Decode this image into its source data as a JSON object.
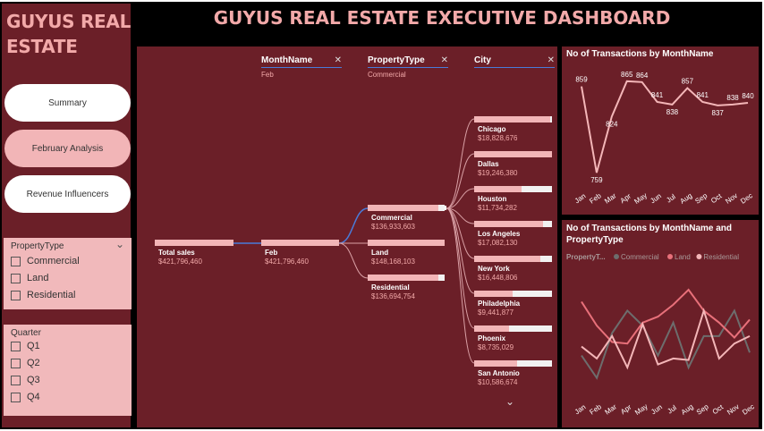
{
  "app": {
    "title": "GUYUS REAL ESTATE",
    "dashboard_title": "GUYUS REAL ESTATE EXECUTIVE DASHBOARD"
  },
  "nav": {
    "summary": "Summary",
    "february": "February Analysis",
    "revenue": "Revenue Influencers"
  },
  "slicers": {
    "property_type": {
      "title": "PropertyType",
      "options": [
        "Commercial",
        "Land",
        "Residential"
      ]
    },
    "quarter": {
      "title": "Quarter",
      "options": [
        "Q1",
        "Q2",
        "Q3",
        "Q4"
      ]
    }
  },
  "tree": {
    "levels": [
      {
        "name": "MonthName",
        "selected": "Feb"
      },
      {
        "name": "PropertyType",
        "selected": "Commercial"
      },
      {
        "name": "City",
        "selected": ""
      }
    ],
    "root": {
      "label": "Total sales",
      "value": "$421,796,460"
    },
    "month": {
      "label": "Feb",
      "value": "$421,796,460"
    },
    "types": [
      {
        "label": "Commercial",
        "value": "$136,933,603",
        "fill": 0.92
      },
      {
        "label": "Land",
        "value": "$148,168,103",
        "fill": 1.0
      },
      {
        "label": "Residential",
        "value": "$136,694,754",
        "fill": 0.92
      }
    ],
    "cities": [
      {
        "label": "Chicago",
        "value": "$18,828,676",
        "fill": 0.98
      },
      {
        "label": "Dallas",
        "value": "$19,246,380",
        "fill": 1.0
      },
      {
        "label": "Houston",
        "value": "$11,734,282",
        "fill": 0.61
      },
      {
        "label": "Los Angeles",
        "value": "$17,082,130",
        "fill": 0.89
      },
      {
        "label": "New York",
        "value": "$16,448,806",
        "fill": 0.85
      },
      {
        "label": "Philadelphia",
        "value": "$9,441,877",
        "fill": 0.49
      },
      {
        "label": "Phoenix",
        "value": "$8,735,029",
        "fill": 0.45
      },
      {
        "label": "San Antonio",
        "value": "$10,586,674",
        "fill": 0.55
      }
    ],
    "more_icon": "chevron-down-icon"
  },
  "chart1": {
    "title": "No of Transactions by MonthName"
  },
  "chart2": {
    "title": "No of Transactions by MonthName and PropertyType",
    "legend_title": "PropertyT...",
    "colors": [
      "#6d6d6d",
      "#e8707a",
      "#f4b6b8"
    ]
  },
  "chart_data": [
    {
      "type": "line",
      "title": "No of Transactions by MonthName",
      "categories": [
        "Jan",
        "Feb",
        "Mar",
        "Apr",
        "May",
        "Jun",
        "Jul",
        "Aug",
        "Sep",
        "Oct",
        "Nov",
        "Dec"
      ],
      "series": [
        {
          "values": [
            859,
            759,
            824,
            865,
            864,
            841,
            838,
            857,
            841,
            837,
            838,
            840
          ]
        }
      ],
      "ylim": [
        755,
        870
      ],
      "color": "#f4b6b8"
    },
    {
      "type": "line",
      "title": "No of Transactions by MonthName and PropertyType",
      "categories": [
        "Jan",
        "Feb",
        "Mar",
        "Apr",
        "May",
        "Jun",
        "Jul",
        "Aug",
        "Sep",
        "Oct",
        "Nov",
        "Dec"
      ],
      "series": [
        {
          "name": "Commercial",
          "values": [
            270,
            255,
            285,
            300,
            290,
            270,
            292,
            262,
            283,
            283,
            300,
            272
          ]
        },
        {
          "name": "Land",
          "values": [
            306,
            290,
            279,
            278,
            292,
            296,
            304,
            314,
            300,
            292,
            282,
            294
          ]
        },
        {
          "name": "Residential",
          "values": [
            276,
            268,
            283,
            262,
            291,
            264,
            268,
            267,
            300,
            268,
            278,
            283
          ]
        }
      ],
      "ylim": [
        250,
        320
      ],
      "legend": "top-left"
    }
  ]
}
